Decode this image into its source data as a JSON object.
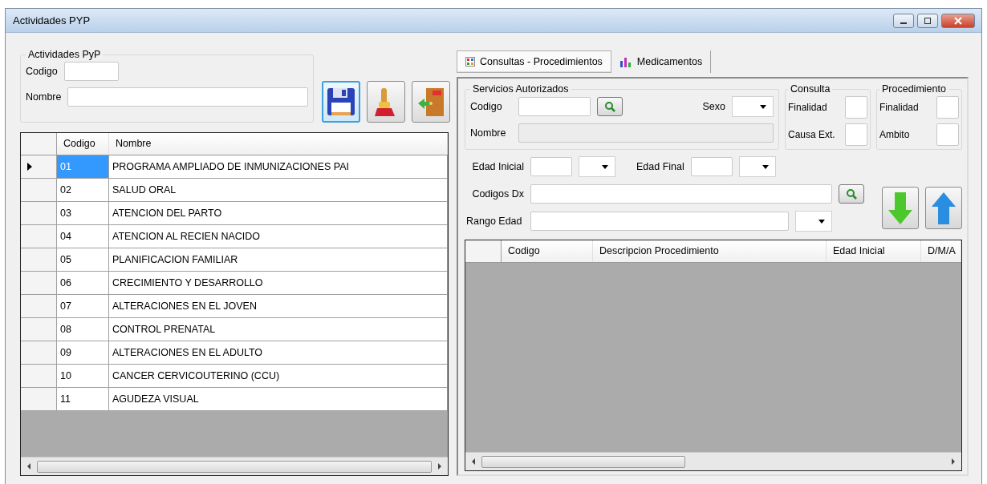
{
  "window": {
    "title": "Actividades PYP"
  },
  "activity_group": {
    "title": "Actividades PyP",
    "fields": [
      {
        "label": "Codigo"
      },
      {
        "label": "Nombre"
      }
    ]
  },
  "toolbar": [
    {
      "kind": "save"
    },
    {
      "kind": "clean"
    },
    {
      "kind": "exit"
    }
  ],
  "activities_table": {
    "columns": [
      "Codigo",
      "Nombre"
    ],
    "rows": [
      {
        "code": "01",
        "name": "PROGRAMA AMPLIADO DE INMUNIZACIONES PAI",
        "selected": true
      },
      {
        "code": "02",
        "name": "SALUD ORAL",
        "selected": false
      },
      {
        "code": "03",
        "name": "ATENCION DEL PARTO",
        "selected": false
      },
      {
        "code": "04",
        "name": "ATENCION AL RECIEN NACIDO",
        "selected": false
      },
      {
        "code": "05",
        "name": "PLANIFICACION FAMILIAR",
        "selected": false
      },
      {
        "code": "06",
        "name": "CRECIMIENTO Y DESARROLLO",
        "selected": false
      },
      {
        "code": "07",
        "name": "ALTERACIONES EN EL JOVEN",
        "selected": false
      },
      {
        "code": "08",
        "name": "CONTROL PRENATAL",
        "selected": false
      },
      {
        "code": "09",
        "name": "ALTERACIONES EN EL ADULTO",
        "selected": false
      },
      {
        "code": "10",
        "name": "CANCER CERVICOUTERINO (CCU)",
        "selected": false
      },
      {
        "code": "11",
        "name": "AGUDEZA VISUAL",
        "selected": false
      }
    ]
  },
  "tabs": [
    {
      "label": "Consultas - Procedimientos",
      "kind": "grid",
      "selected": true
    },
    {
      "label": "Medicamentos",
      "kind": "chart",
      "selected": false
    }
  ],
  "services_group": {
    "title": "Servicios Autorizados",
    "code_label": "Codigo",
    "sex_label": "Sexo",
    "name_label": "Nombre",
    "name_disabled": true
  },
  "consulta_group": {
    "title": "Consulta",
    "labels": [
      "Finalidad",
      "Causa Ext."
    ]
  },
  "procedimiento_group": {
    "title": "Procedimiento",
    "labels": [
      "Finalidad",
      "Ambito"
    ]
  },
  "age": {
    "initial_label": "Edad Inicial",
    "final_label": "Edad Final"
  },
  "dx_label": "Codigos Dx",
  "range_label": "Rango Edad",
  "procedures_table": {
    "columns": [
      "Codigo",
      "Descripcion Procedimiento",
      "Edad Inicial",
      "D/M/A"
    ]
  }
}
